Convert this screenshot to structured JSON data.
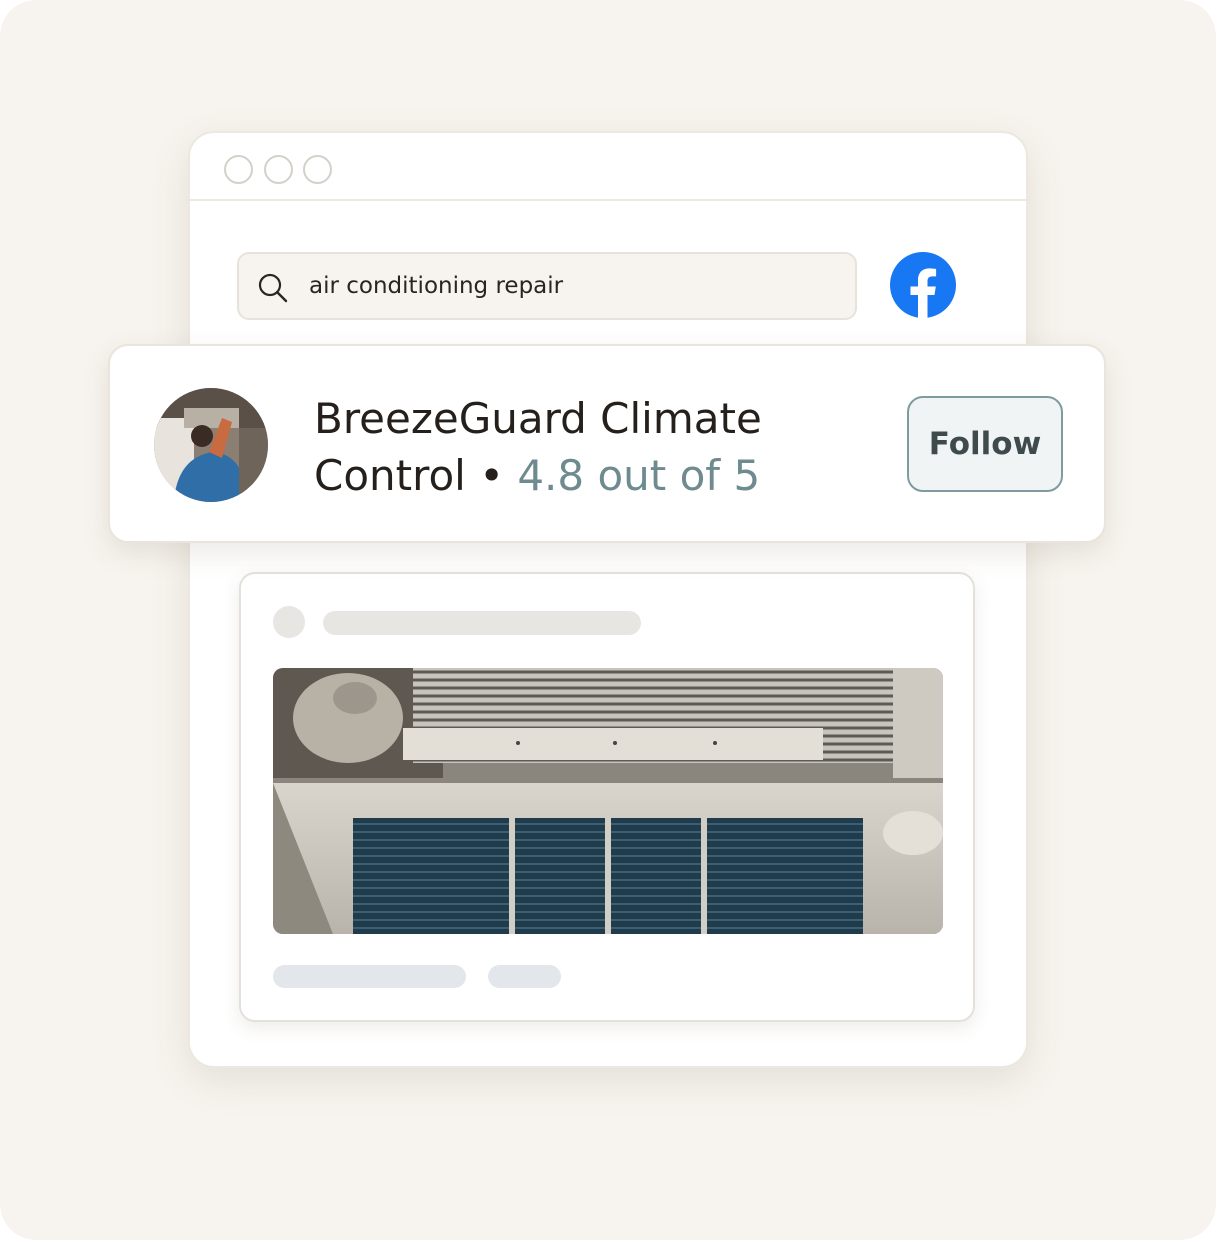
{
  "search": {
    "query": "air conditioning repair"
  },
  "social": {
    "icon": "facebook-icon",
    "color": "#1877f2"
  },
  "profile": {
    "name_line1": "BreezeGuard Climate",
    "name_line2": "Control",
    "separator": "•",
    "rating": "4.8 out of 5",
    "follow_label": "Follow"
  },
  "colors": {
    "background": "#f7f4ef",
    "rating_text": "#6f8b90",
    "follow_border": "#7e9b9f"
  }
}
